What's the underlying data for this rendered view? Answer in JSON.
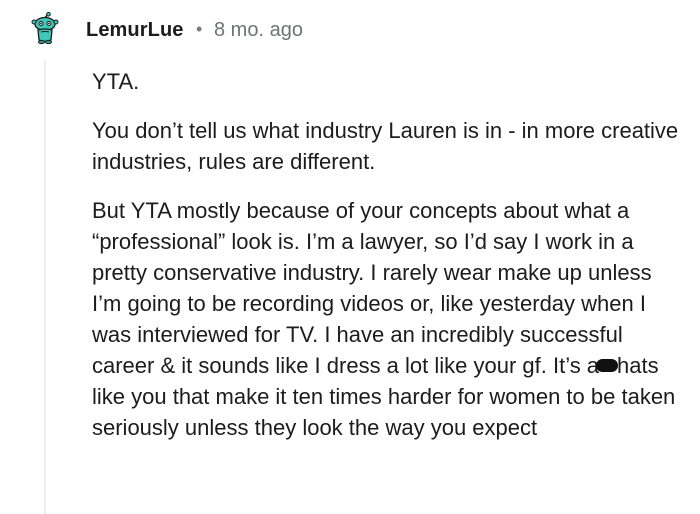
{
  "comment": {
    "author": "LemurLue",
    "separator": "•",
    "timestamp": "8 mo. ago",
    "avatar_icon": "snoo-avatar-icon",
    "paragraphs": [
      "YTA.",
      "You don’t tell us what industry Lauren is in - in more creative industries, rules are different.",
      "But YTA mostly because of your concepts about what a “professional” look is. I’m a lawyer, so I’d say I work in a pretty conservative industry. I rarely wear make up unless I’m going to be recording videos or, like yesterday when I was interviewed for TV. I have an incredibly successful career & it sounds like I dress a lot like your gf. It’s a"
    ],
    "paragraph3_after_redaction": "hats like you that make it ten times harder for women to be taken seriously unless they look the way you expect"
  },
  "colors": {
    "avatar_teal": "#3ec9b8",
    "thread_line": "#edeff1",
    "muted_text": "#6f7375"
  }
}
